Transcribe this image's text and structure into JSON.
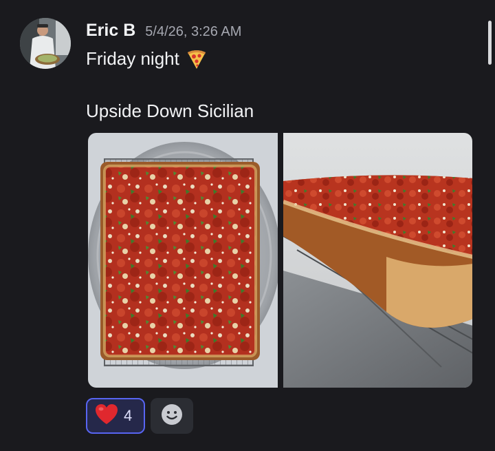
{
  "message": {
    "author": "Eric B",
    "timestamp": "5/4/26, 3:26 AM",
    "lines": [
      {
        "text": "Friday night",
        "emoji": "pizza-icon"
      },
      {
        "text": "Upside Down Sicilian"
      }
    ],
    "attachments": [
      {
        "kind": "image",
        "subject": "square-sicilian-pizza-top-view"
      },
      {
        "kind": "image",
        "subject": "square-sicilian-pizza-side-view"
      }
    ]
  },
  "reactions": [
    {
      "emoji": "red-heart-icon",
      "count": "4",
      "selected": true
    }
  ],
  "add_reaction": {
    "icon": "add-reaction-smiley-icon"
  },
  "colors": {
    "background": "#1a1a1e",
    "selected_reaction_border": "#5865f2",
    "selected_reaction_bg": "#25284a",
    "timestamp": "#a6a8b1"
  }
}
